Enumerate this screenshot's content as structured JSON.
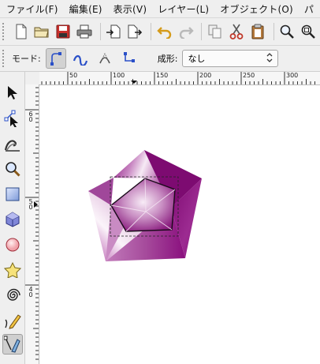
{
  "menu": [
    {
      "id": "file",
      "label": "ファイル(F)"
    },
    {
      "id": "edit",
      "label": "編集(E)"
    },
    {
      "id": "view",
      "label": "表示(V)"
    },
    {
      "id": "layer",
      "label": "レイヤー(L)"
    },
    {
      "id": "object",
      "label": "オブジェクト(O)"
    },
    {
      "id": "more",
      "label": "パ"
    }
  ],
  "toolbar": {
    "icons": [
      "new-document-icon",
      "open-folder-icon",
      "save-icon",
      "print-icon",
      "import-icon",
      "export-icon",
      "undo-icon",
      "redo-icon",
      "duplicate-icon",
      "cut-icon",
      "paste-icon",
      "zoom-icon",
      "zoom-fit-icon"
    ]
  },
  "controls": {
    "mode_label": "モード:",
    "shape_label": "成形:",
    "shape_value": "なし",
    "modes": [
      "bezier-mode-icon",
      "spiro-mode-icon",
      "bspline-mode-icon",
      "paraxial-mode-icon"
    ]
  },
  "rulers": {
    "h_labels": [
      "50",
      "100",
      "150",
      "200",
      "250",
      "300"
    ],
    "v_labels": [
      "6\n0",
      "5\n0",
      "4\n0"
    ]
  },
  "tools": [
    "selector-tool-icon",
    "node-tool-icon",
    "tweak-tool-icon",
    "zoom-tool-icon",
    "rect-tool-icon",
    "3dbox-tool-icon",
    "ellipse-tool-icon",
    "star-tool-icon",
    "spiral-tool-icon",
    "pencil-tool-icon",
    "pen-tool-icon"
  ],
  "colors": {
    "gem_dark": "#8a0f7e",
    "gem_mid": "#b04aa6",
    "gem_light": "#f4e6f3",
    "ui_bg": "#efefef"
  }
}
